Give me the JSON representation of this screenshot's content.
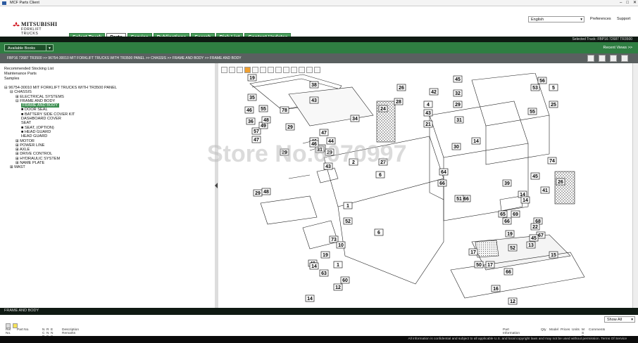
{
  "window": {
    "title": "MCF Parts Client",
    "controls": [
      "–",
      "□",
      "✕"
    ]
  },
  "brand": {
    "name": "MITSUBISHI",
    "sub": "FORKLIFT TRUCKS"
  },
  "nav": {
    "tabs": [
      {
        "label": "Select Truck",
        "active": false
      },
      {
        "label": "Parts",
        "active": true
      },
      {
        "label": "Service",
        "active": false
      },
      {
        "label": "Publications",
        "active": false
      },
      {
        "label": "Search",
        "active": false
      },
      {
        "label": "Pick List",
        "active": false
      },
      {
        "label": "Content Updates",
        "active": false
      }
    ]
  },
  "top": {
    "language": "English",
    "preferences": "Preferences",
    "support": "Support"
  },
  "selected_truck": "Selected Truck:  FBP16 72687 TR3500",
  "toolbar": {
    "available_books": "Available Books",
    "recent_views": "Recent Views >>"
  },
  "breadcrumb": "FBP16 72687 TR3500 >> 96754-30010 MIT FORKLIFT TRUCKS WITH TR3500 PANEL >> CHASSIS >> FRAME AND BODY >> FRAME AND BODY",
  "left": {
    "links": [
      "Recommended Stocking List",
      "Maintenance Parts",
      "Samples"
    ],
    "tree": [
      {
        "level": 0,
        "sign": "⊟",
        "label": "96754-30010 MIT FORKLIFT TRUCKS WITH TR3500 PANEL"
      },
      {
        "level": 1,
        "sign": "⊟",
        "label": "CHASSIS"
      },
      {
        "level": 2,
        "sign": "⊞",
        "label": "ELECTRICAL SYSTEMS"
      },
      {
        "level": 2,
        "sign": "⊟",
        "label": "FRAME AND BODY"
      },
      {
        "level": 3,
        "sign": "",
        "label": "FRAME AND BODY",
        "selected": true
      },
      {
        "level": 3,
        "sign": "■",
        "label": "DOOR SEAL"
      },
      {
        "level": 3,
        "sign": "■",
        "label": "BATTERY SIDE COVER KIT"
      },
      {
        "level": 3,
        "sign": "",
        "label": "DASHBOARD COVER"
      },
      {
        "level": 3,
        "sign": "",
        "label": "SEAT"
      },
      {
        "level": 3,
        "sign": "■",
        "label": "SEAT, (OPTION)"
      },
      {
        "level": 3,
        "sign": "■",
        "label": "HEAD GUARD"
      },
      {
        "level": 3,
        "sign": "",
        "label": "HEAD GUARD"
      },
      {
        "level": 2,
        "sign": "⊞",
        "label": "MOTOR"
      },
      {
        "level": 2,
        "sign": "⊞",
        "label": "POWER LINE"
      },
      {
        "level": 2,
        "sign": "⊞",
        "label": "AXLE"
      },
      {
        "level": 2,
        "sign": "⊞",
        "label": "DRIVE CONTROL"
      },
      {
        "level": 2,
        "sign": "⊞",
        "label": "HYDRAULIC SYSTEM"
      },
      {
        "level": 2,
        "sign": "⊞",
        "label": "NAME PLATE"
      },
      {
        "level": 1,
        "sign": "⊞",
        "label": "MAST"
      }
    ]
  },
  "watermark": "Store No.6070997",
  "diagram": {
    "callouts": [
      "19",
      "35",
      "46",
      "36",
      "57",
      "49",
      "48",
      "47",
      "46",
      "45",
      "78",
      "29",
      "29",
      "34",
      "55",
      "31",
      "29",
      "29",
      "48",
      "47",
      "44",
      "46",
      "19",
      "12",
      "52",
      "1",
      "2",
      "43",
      "14",
      "38",
      "43",
      "6",
      "48",
      "73",
      "10",
      "1",
      "14",
      "63",
      "60",
      "28",
      "24",
      "26",
      "42",
      "32",
      "29",
      "45",
      "30",
      "64",
      "66",
      "14",
      "17",
      "16",
      "12",
      "21",
      "43",
      "31",
      "56",
      "53",
      "74",
      "55",
      "6",
      "27",
      "66",
      "65",
      "66",
      "39",
      "45",
      "41",
      "14",
      "26",
      "69",
      "68",
      "22",
      "67",
      "19",
      "15",
      "50",
      "17",
      "66",
      "51",
      "14",
      "52",
      "13",
      "45",
      "4",
      "5",
      "25"
    ]
  },
  "bottom": {
    "title": "FRAME AND BODY",
    "show_all": "Show All",
    "columns": [
      "Ref\nNo.",
      "Part No.",
      "N\nC\nP",
      "R\nN\nS",
      "E\nN\nS",
      "Description\nRemarks",
      "Part\nInformation",
      "Qty",
      "Model",
      "Prices",
      "Units",
      "M\nS\nD",
      "Comments"
    ]
  },
  "footer": "All information is confidential and subject to all applicable U.S. and local copyright laws and may not be used without permission.  Terms Of Service"
}
